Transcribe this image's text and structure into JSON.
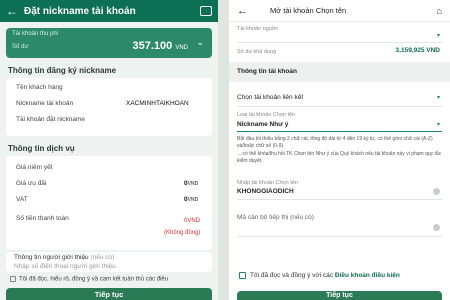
{
  "left": {
    "header": {
      "title": "Đặt nickname tài khoản"
    },
    "account": {
      "label": "Tài khoản thu phí",
      "sub": "Số dư",
      "balance": "357.100",
      "currency": "VND"
    },
    "reg_section": "Thông tin đăng ký nickname",
    "reg_rows": [
      {
        "label": "Tên khách hàng",
        "value": ""
      },
      {
        "label": "Nickname tài khoản",
        "value": "XACMINHTAIKHOAN"
      },
      {
        "label": "Tài khoản đặt nickname",
        "value": ""
      }
    ],
    "svc_section": "Thông tin dịch vụ",
    "svc_rows": [
      {
        "label": "Giá niêm yết",
        "value": ""
      },
      {
        "label": "Giá ưu đãi",
        "value": "0",
        "unit": "VND"
      },
      {
        "label": "VAT",
        "value": "0",
        "unit": "VND"
      },
      {
        "label": "Số tiền thanh toán",
        "value": "0",
        "unit": "VND",
        "note": "(Không đồng)"
      }
    ],
    "referrer": {
      "label": "Thông tin người giới thiệu",
      "optional": "(nếu có)",
      "placeholder": "Nhập số điện thoại người giới thiệu"
    },
    "agree_text": "Tôi đã đọc, hiểu rõ, đồng ý và cam kết tuân thủ các điều",
    "continue": "Tiếp tục"
  },
  "right": {
    "header": {
      "title": "Mở tài khoản Chọn tên"
    },
    "source": {
      "label": "Tài khoản nguồn",
      "balance_label": "Số dư khả dụng",
      "balance": "3,159,925 VND"
    },
    "info_section": "Thông tin tài khoản",
    "linked": "Chọn tài khoản liên kết",
    "type": {
      "label": "Loại tài khoản Chọn tên",
      "value": "Nickname Như ý"
    },
    "desc1": "Bắt đầu tối thiểu bằng 2 chữ cái, tổng độ dài từ 4 đến 19 ký tự, có thể gồm chữ cái (A-Z) và/hoặc chữ số (0-9).",
    "desc2": "... có thể khóa/thu hồi TK Chọn tên Như ý của Quý khách nếu tài khoản này vi phạm quy tắc kiểm duyệt.",
    "name_input": {
      "label": "Nhập tài khoản Chọn tên",
      "value": "KHONGGIAODICH"
    },
    "ref_placeholder": "Mã cán bộ tiếp thị (nếu có)",
    "agree": {
      "text": "Tôi đã đọc và đồng ý với các",
      "link": "Điều khoản điều kiện"
    },
    "continue": "Tiếp tục"
  }
}
